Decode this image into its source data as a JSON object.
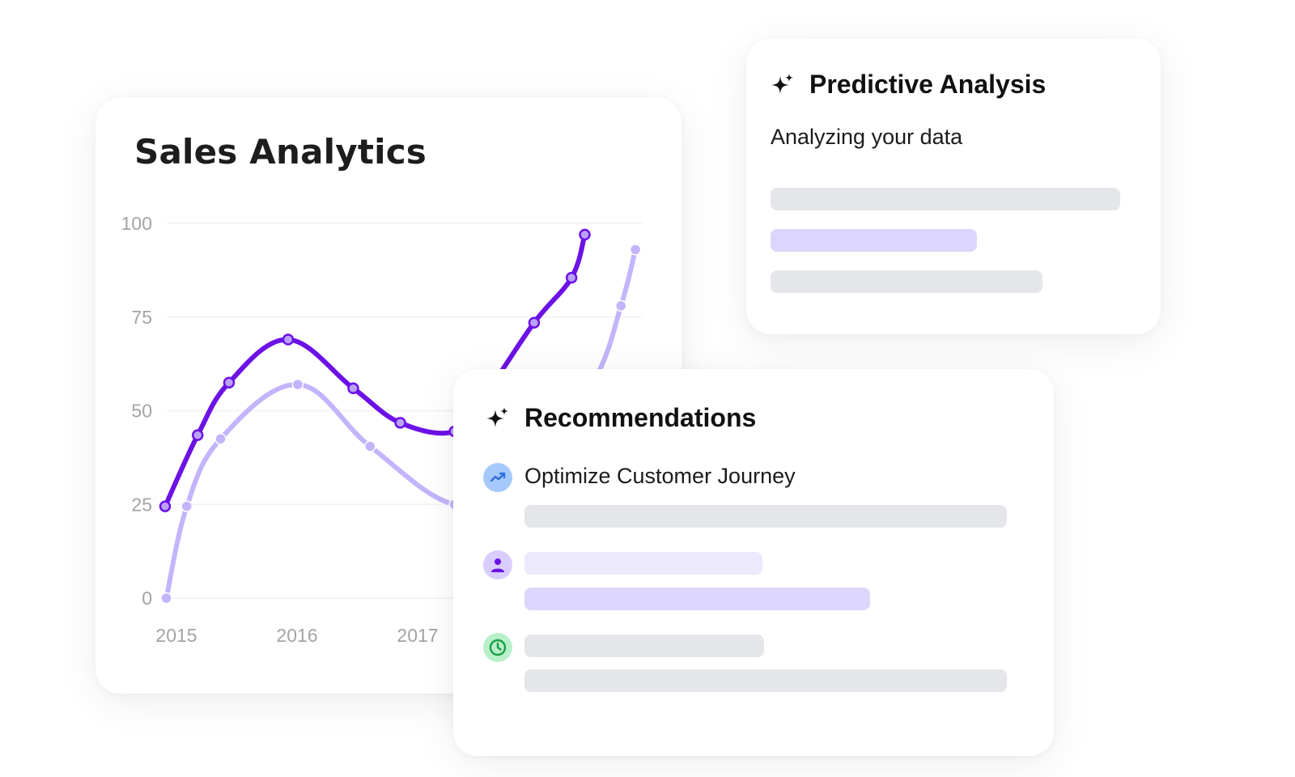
{
  "sales_card": {
    "title": "Sales Analytics"
  },
  "chart_data": {
    "type": "line",
    "title": "Sales Analytics",
    "x": [
      2015,
      2015.25,
      2015.5,
      2016,
      2016.5,
      2017.4,
      2018.2,
      2018.4,
      2018.6
    ],
    "x_ticks": [
      "2015",
      "2016",
      "2017"
    ],
    "y_ticks": [
      "0",
      "25",
      "50",
      "75",
      "100"
    ],
    "ylim": [
      0,
      100
    ],
    "grid": true,
    "series": [
      {
        "color": "#6c12e6",
        "points": [
          {
            "x": 2015.0,
            "y": 24.5
          },
          {
            "x": 2015.27,
            "y": 43.5
          },
          {
            "x": 2015.53,
            "y": 57.5
          },
          {
            "x": 2016.02,
            "y": 69.0
          },
          {
            "x": 2016.56,
            "y": 56.0
          },
          {
            "x": 2016.95,
            "y": 46.8
          },
          {
            "x": 2017.4,
            "y": 44.5
          },
          {
            "x": 2017.65,
            "y": 54.0
          },
          {
            "x": 2018.06,
            "y": 73.5
          },
          {
            "x": 2018.37,
            "y": 85.5
          },
          {
            "x": 2018.48,
            "y": 97.0
          }
        ]
      },
      {
        "color": "#c3b4fc",
        "points": [
          {
            "x": 2015.01,
            "y": 0.0
          },
          {
            "x": 2015.18,
            "y": 24.5
          },
          {
            "x": 2015.46,
            "y": 42.5
          },
          {
            "x": 2016.1,
            "y": 57.0
          },
          {
            "x": 2016.7,
            "y": 40.5
          },
          {
            "x": 2017.4,
            "y": 25.0
          },
          {
            "x": 2017.98,
            "y": 31.0
          },
          {
            "x": 2018.55,
            "y": 57.5
          },
          {
            "x": 2018.78,
            "y": 78.0
          },
          {
            "x": 2018.9,
            "y": 93.0
          }
        ]
      }
    ]
  },
  "predictive_card": {
    "title": "Predictive Analysis",
    "subtitle": "Analyzing your data",
    "icon": "sparkle-icon"
  },
  "recommendations_card": {
    "title": "Recommendations",
    "icon": "sparkle-icon",
    "items": [
      {
        "icon": "trending-up-icon",
        "label": "Optimize Customer Journey",
        "color": "#2f6fe0",
        "bg": "#a5c9fb"
      },
      {
        "icon": "user-icon",
        "label": "",
        "color": "#6c12e6",
        "bg": "#d9cdfd"
      },
      {
        "icon": "clock-icon",
        "label": "",
        "color": "#1f9d4a",
        "bg": "#b7f0c9"
      }
    ]
  },
  "colors": {
    "primary_line": "#6c12e6",
    "secondary_line": "#c3b4fc",
    "skeleton_gray": "#e5e6ea",
    "skeleton_purple": "#dcd6fc"
  }
}
